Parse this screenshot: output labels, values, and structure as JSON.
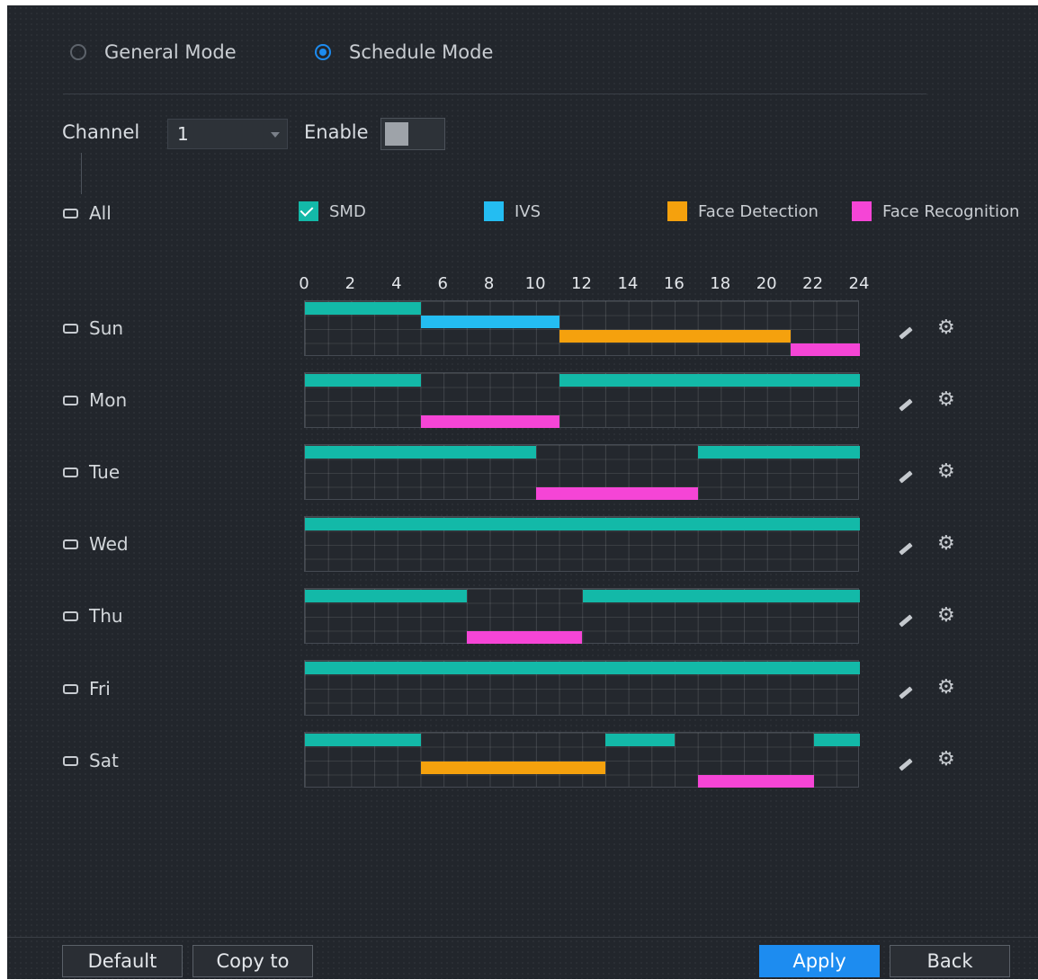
{
  "mode": {
    "general_label": "General Mode",
    "schedule_label": "Schedule Mode",
    "selected": "schedule"
  },
  "channel": {
    "label": "Channel",
    "value": "1"
  },
  "enable": {
    "label": "Enable",
    "on": false
  },
  "all_label": "All",
  "legend": [
    {
      "label": "SMD",
      "color": "#13b9a8",
      "checked": true
    },
    {
      "label": "IVS",
      "color": "#24bdf2",
      "checked": false
    },
    {
      "label": "Face Detection",
      "color": "#f5a10d",
      "checked": false
    },
    {
      "label": "Face Recognition",
      "color": "#f545d6",
      "checked": false
    }
  ],
  "hour_ticks": [
    "0",
    "2",
    "4",
    "6",
    "8",
    "10",
    "12",
    "14",
    "16",
    "18",
    "20",
    "22",
    "24"
  ],
  "days": [
    {
      "label": "Sun",
      "segments": [
        {
          "type": "SMD",
          "start": 0,
          "end": 5,
          "lane": 0
        },
        {
          "type": "IVS",
          "start": 5,
          "end": 11,
          "lane": 1
        },
        {
          "type": "Face Detection",
          "start": 11,
          "end": 21,
          "lane": 2
        },
        {
          "type": "Face Recognition",
          "start": 21,
          "end": 24,
          "lane": 3
        }
      ]
    },
    {
      "label": "Mon",
      "segments": [
        {
          "type": "SMD",
          "start": 0,
          "end": 5,
          "lane": 0
        },
        {
          "type": "SMD",
          "start": 11,
          "end": 24,
          "lane": 0
        },
        {
          "type": "Face Recognition",
          "start": 5,
          "end": 11,
          "lane": 3
        }
      ]
    },
    {
      "label": "Tue",
      "segments": [
        {
          "type": "SMD",
          "start": 0,
          "end": 10,
          "lane": 0
        },
        {
          "type": "SMD",
          "start": 17,
          "end": 24,
          "lane": 0
        },
        {
          "type": "Face Recognition",
          "start": 10,
          "end": 17,
          "lane": 3
        }
      ]
    },
    {
      "label": "Wed",
      "segments": [
        {
          "type": "SMD",
          "start": 0,
          "end": 24,
          "lane": 0
        }
      ]
    },
    {
      "label": "Thu",
      "segments": [
        {
          "type": "SMD",
          "start": 0,
          "end": 7,
          "lane": 0
        },
        {
          "type": "SMD",
          "start": 12,
          "end": 24,
          "lane": 0
        },
        {
          "type": "Face Recognition",
          "start": 7,
          "end": 12,
          "lane": 3
        }
      ]
    },
    {
      "label": "Fri",
      "segments": [
        {
          "type": "SMD",
          "start": 0,
          "end": 24,
          "lane": 0
        }
      ]
    },
    {
      "label": "Sat",
      "segments": [
        {
          "type": "SMD",
          "start": 0,
          "end": 5,
          "lane": 0
        },
        {
          "type": "SMD",
          "start": 13,
          "end": 16,
          "lane": 0
        },
        {
          "type": "SMD",
          "start": 22,
          "end": 24,
          "lane": 0
        },
        {
          "type": "Face Detection",
          "start": 5,
          "end": 13,
          "lane": 2
        },
        {
          "type": "Face Recognition",
          "start": 17,
          "end": 22,
          "lane": 3
        }
      ]
    }
  ],
  "buttons": {
    "default": "Default",
    "copy_to": "Copy to",
    "apply": "Apply",
    "back": "Back"
  }
}
